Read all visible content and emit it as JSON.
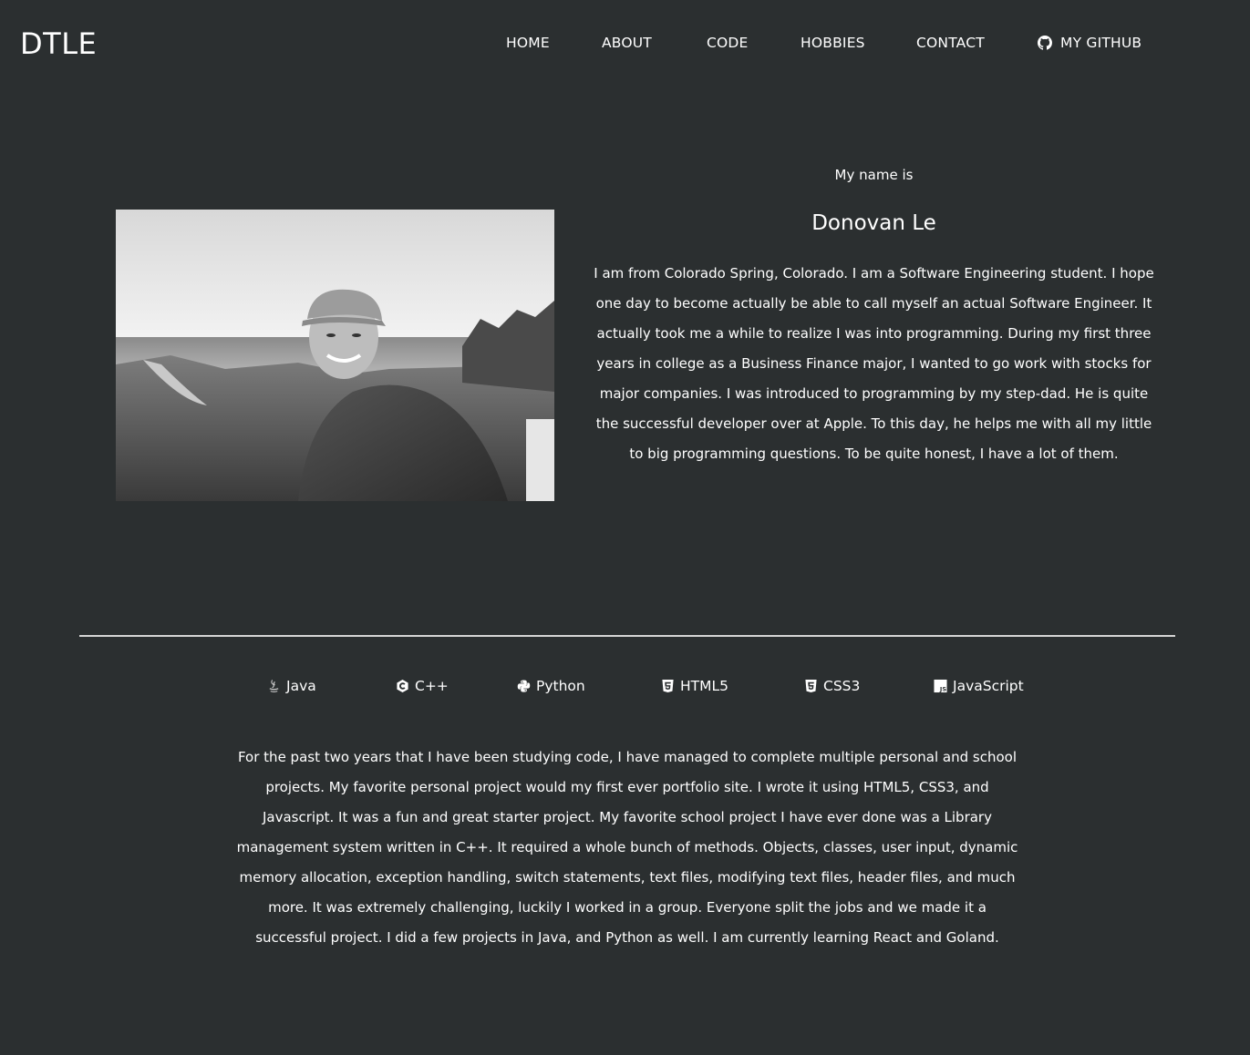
{
  "nav": {
    "brand": "DTLE",
    "links": [
      "HOME",
      "ABOUT",
      "CODE",
      "HOBBIES",
      "CONTACT"
    ],
    "github_label": "MY GITHUB",
    "github_icon": "github-icon"
  },
  "about": {
    "intro": "My name is",
    "name": "Donovan Le",
    "bio": "I am from Colorado Spring, Colorado. I am a Software Engineering student. I hope one day to become actually be able to call myself an actual Software Engineer. It actually took me a while to realize I was into programming. During my first three years in college as a Business Finance major, I wanted to go work with stocks for major companies. I was introduced to programming by my step-dad. He is quite the successful developer over at Apple. To this day, he helps me with all my little to big programming questions. To be quite honest, I have a lot of them."
  },
  "skills": [
    {
      "label": "Java",
      "icon": "java-icon"
    },
    {
      "label": "C++",
      "icon": "cplusplus-icon"
    },
    {
      "label": "Python",
      "icon": "python-icon"
    },
    {
      "label": "HTML5",
      "icon": "html5-icon"
    },
    {
      "label": "CSS3",
      "icon": "css3-icon"
    },
    {
      "label": "JavaScript",
      "icon": "javascript-icon"
    }
  ],
  "code": {
    "text": "For the past two years that I have been studying code, I have managed to complete multiple personal and school projects. My favorite personal project would my first ever portfolio site. I wrote it using HTML5, CSS3, and Javascript. It was a fun and great starter project. My favorite school project I have ever done was a Library management system written in C++. It required a whole bunch of methods. Objects, classes, user input, dynamic memory allocation, exception handling, switch statements, text files, modifying text files, header files, and much more. It was extremely challenging, luckily I worked in a group. Everyone split the jobs and we made it a successful project. I did a few projects in Java, and Python as well. I am currently learning React and Goland."
  },
  "colors": {
    "background": "#2b2f30",
    "text": "#ffffff",
    "divider": "#d6d6d6"
  }
}
